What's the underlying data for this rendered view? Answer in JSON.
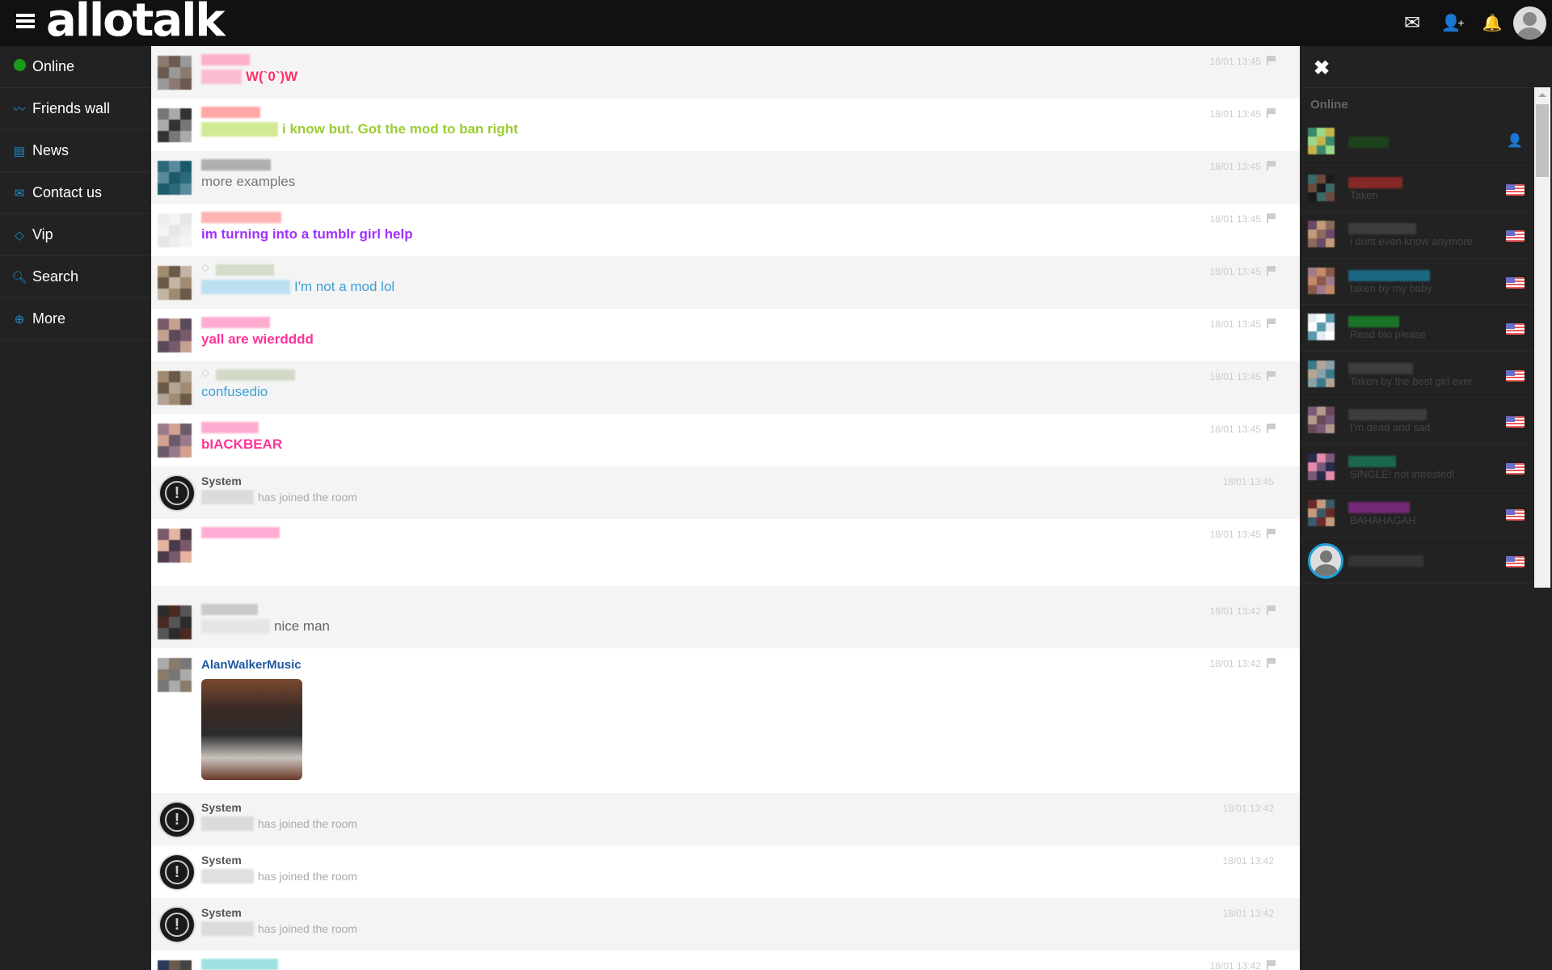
{
  "header": {
    "logo": "allotalk",
    "icons": [
      "menu-icon",
      "envelope-icon",
      "add-user-icon",
      "bell-icon",
      "avatar"
    ]
  },
  "sidebar": {
    "items": [
      {
        "label": "Online",
        "icon": "online-dot-icon",
        "color": "#1a9a1a"
      },
      {
        "label": "Friends wall",
        "icon": "rss-icon"
      },
      {
        "label": "News",
        "icon": "newspaper-icon"
      },
      {
        "label": "Contact us",
        "icon": "envelope-icon"
      },
      {
        "label": "Vip",
        "icon": "diamond-icon"
      },
      {
        "label": "Search",
        "icon": "search-icon"
      },
      {
        "label": "More",
        "icon": "plus-circle-icon"
      }
    ]
  },
  "chat": {
    "messages": [
      {
        "type": "user",
        "text": "W(`0`)W",
        "color": "#ff3366",
        "bold": true,
        "time": "18/01 13:45",
        "name_color": "#ff9ab8",
        "avatar": [
          "#8a7a70",
          "#6a5a50",
          "#999"
        ],
        "prefix_blur": true
      },
      {
        "type": "user",
        "text": "i know but. Got the mod to ban right",
        "color": "#9acd32",
        "bold": true,
        "time": "18/01 13:45",
        "name_color": "#ff8a8a",
        "avatar": [
          "#777",
          "#aaa",
          "#333"
        ],
        "prefix_blur": true
      },
      {
        "type": "user",
        "text": "more examples",
        "color": "#777777",
        "bold": false,
        "time": "18/01 13:45",
        "name_color": "#999999",
        "avatar": [
          "#2a6a7a",
          "#5a8a9a",
          "#1a5a6a"
        ]
      },
      {
        "type": "user",
        "text": "im turning into a tumblr girl help",
        "color": "#a030ff",
        "bold": true,
        "time": "18/01 13:45",
        "name_color": "#ff9a9a",
        "avatar": [
          "#eee",
          "#f4f4f4",
          "#e6e6e6"
        ]
      },
      {
        "type": "user",
        "text": "I'm not a mod lol",
        "color": "#3aa0d8",
        "bold": false,
        "time": "18/01 13:45",
        "name_color": "#c8d4b8",
        "avatar": [
          "#a08a70",
          "#6a5a4a",
          "#c4b4a4"
        ],
        "prefix_blur": true,
        "vip": true
      },
      {
        "type": "user",
        "text": "yall are wierdddd",
        "color": "#ff3399",
        "bold": true,
        "time": "18/01 13:45",
        "name_color": "#ff90c0",
        "avatar": [
          "#7a5a6a",
          "#c4a090",
          "#5a4a5a"
        ]
      },
      {
        "type": "user",
        "text": "confusedio",
        "color": "#3aa0d8",
        "bold": false,
        "time": "18/01 13:45",
        "name_color": "#c8d0b8",
        "avatar": [
          "#a08a70",
          "#6a5a4a",
          "#b4a494"
        ],
        "vip": true
      },
      {
        "type": "user",
        "text": "bIACKBEAR",
        "color": "#ff3399",
        "bold": true,
        "time": "18/01 13:45",
        "name_color": "#ff90c0",
        "avatar": [
          "#9a7a8a",
          "#d4a090",
          "#6a5a6a"
        ]
      },
      {
        "type": "system",
        "name": "System",
        "text": "has joined the room",
        "time": "18/01 13:45"
      },
      {
        "type": "user",
        "text": "",
        "color": "#ff3366",
        "bold": false,
        "time": "18/01 13:45",
        "name_color": "#ff90c8",
        "avatar": [
          "#7a5a6a",
          "#e4b4a0",
          "#4a3a4a"
        ],
        "tall": true
      },
      {
        "type": "user",
        "text": "nice man",
        "color": "#666666",
        "bold": false,
        "time": "18/01 13:42",
        "name_color": "#bbbbbb",
        "avatar": [
          "#2a2a2a",
          "#4a2a20",
          "#555"
        ],
        "prefix_blur": true
      },
      {
        "type": "user",
        "name": "AlanWalkerMusic",
        "name_real": true,
        "name_color": "#1e5aa0",
        "text": "",
        "image": true,
        "time": "18/01 13:42",
        "avatar": [
          "#aaa",
          "#8a7a6a",
          "#777"
        ]
      },
      {
        "type": "system",
        "name": "System",
        "text": "has joined the room",
        "time": "18/01 13:42"
      },
      {
        "type": "system",
        "name": "System",
        "text": "has joined the room",
        "time": "18/01 13:42"
      },
      {
        "type": "system",
        "name": "System",
        "text": "has joined the room",
        "time": "18/01 13:42"
      },
      {
        "type": "user",
        "text": "",
        "color": "#666666",
        "bold": false,
        "time": "18/01 13:42",
        "name_color": "#80d8d8",
        "avatar": [
          "#2a3a5a",
          "#6a5a4a",
          "#444"
        ]
      }
    ],
    "open_external_icon": "external-link-icon"
  },
  "right_panel": {
    "close_icon": "close-icon",
    "heading": "Online",
    "users": [
      {
        "status": "",
        "name_color": "#1a4a1a",
        "badge": "user-icon",
        "avatar": [
          "#3a8a6a",
          "#9ad88a",
          "#c4b44a"
        ]
      },
      {
        "status": "Taken",
        "name_color": "#a02a2a",
        "badge": "us-flag-icon",
        "avatar": [
          "#3a6a6a",
          "#6a4a3a",
          "#1a1a1a"
        ]
      },
      {
        "status": "i dont even know anymore.",
        "name_color": "#444444",
        "badge": "us-flag-icon",
        "avatar": [
          "#6a4a6a",
          "#c49a7a",
          "#8a6a5a"
        ]
      },
      {
        "status": "taken by my baby",
        "name_color": "#1a7a9a",
        "badge": "us-flag-icon",
        "avatar": [
          "#a07a8a",
          "#c48a6a",
          "#8a5a4a"
        ]
      },
      {
        "status": "Read bio please",
        "name_color": "#1a8a2a",
        "badge": "us-flag-icon",
        "avatar": [
          "#e4eef4",
          "#ffffff",
          "#5a9aaa"
        ]
      },
      {
        "status": "Taken by the best girl ever",
        "name_color": "#444444",
        "badge": "us-flag-icon",
        "avatar": [
          "#3a7a8a",
          "#b4a494",
          "#8aa0aa"
        ]
      },
      {
        "status": "I'm dead and sad",
        "name_color": "#444444",
        "badge": "us-flag-icon",
        "avatar": [
          "#7a5a7a",
          "#b49a8a",
          "#6a4a5a"
        ]
      },
      {
        "status": "SINGLE! not intrested!",
        "name_color": "#1a7a5a",
        "badge": "us-flag-icon",
        "avatar": [
          "#2a2a4a",
          "#e48aaa",
          "#7a5a7a"
        ]
      },
      {
        "status": "BAHAHAGAH",
        "name_color": "#8a2a8a",
        "badge": "us-flag-icon",
        "avatar": [
          "#6a2a2a",
          "#c49a7a",
          "#3a5a6a"
        ]
      },
      {
        "status": "",
        "name_color": "#3a3a3a",
        "badge": "us-flag-icon",
        "default_avatar": true
      }
    ]
  }
}
